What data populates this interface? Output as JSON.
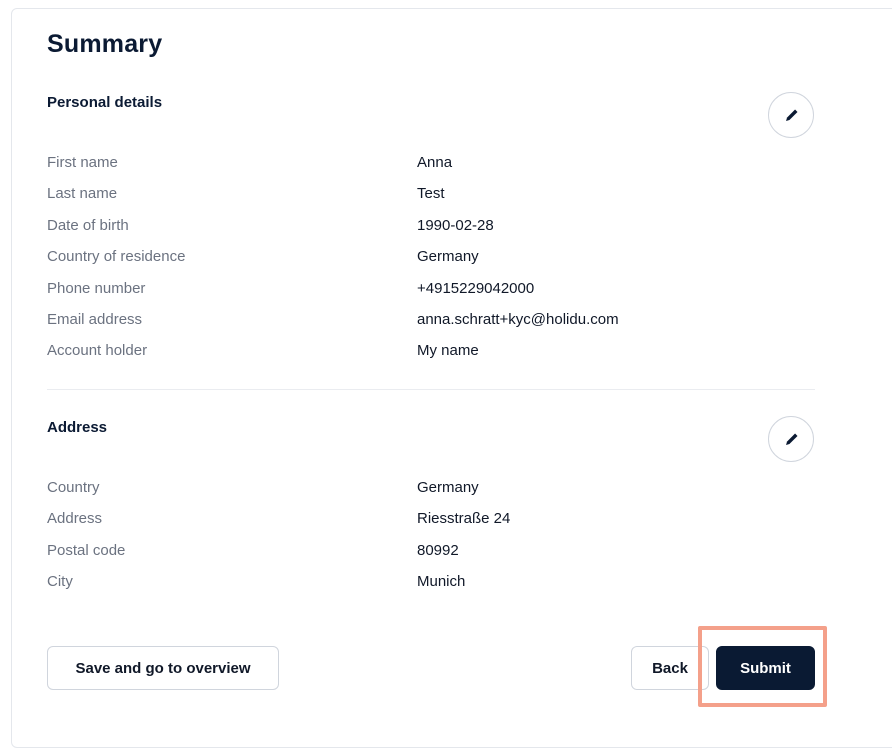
{
  "page_title": "Summary",
  "personal": {
    "title": "Personal details",
    "rows": [
      {
        "label": "First name",
        "value": "Anna"
      },
      {
        "label": "Last name",
        "value": "Test"
      },
      {
        "label": "Date of birth",
        "value": "1990-02-28"
      },
      {
        "label": "Country of residence",
        "value": "Germany"
      },
      {
        "label": "Phone number",
        "value": "+4915229042000"
      },
      {
        "label": "Email address",
        "value": "anna.schratt+kyc@holidu.com"
      },
      {
        "label": "Account holder",
        "value": "My name"
      }
    ]
  },
  "address": {
    "title": "Address",
    "rows": [
      {
        "label": "Country",
        "value": "Germany"
      },
      {
        "label": "Address",
        "value": "Riesstraße 24"
      },
      {
        "label": "Postal code",
        "value": "80992"
      },
      {
        "label": "City",
        "value": "Munich"
      }
    ]
  },
  "footer": {
    "save_label": "Save and go to overview",
    "back_label": "Back",
    "submit_label": "Submit"
  },
  "icons": {
    "edit": "pencil-icon"
  },
  "colors": {
    "primary": "#0a1a33",
    "highlight": "#f4a08a",
    "label": "#6b7280"
  }
}
